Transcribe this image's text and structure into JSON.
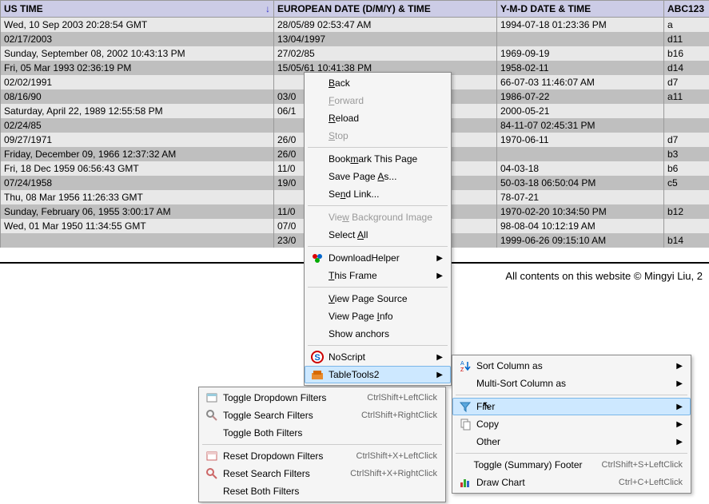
{
  "table": {
    "headers": [
      "US TIME",
      "EUROPEAN DATE (D/M/Y) & TIME",
      "Y-M-D DATE & TIME",
      "ABC123"
    ],
    "sort_col": 0,
    "rows": [
      [
        "Wed, 10 Sep 2003 20:28:54 GMT",
        "28/05/89 02:53:47 AM",
        "1994-07-18 01:23:36 PM",
        "a"
      ],
      [
        "02/17/2003",
        "13/04/1997",
        "",
        "d11"
      ],
      [
        "Sunday, September 08, 2002 10:43:13 PM",
        "27/02/85",
        "1969-09-19",
        "b16"
      ],
      [
        "Fri, 05 Mar 1993 02:36:19 PM",
        "15/05/61 10:41:38 PM",
        "1958-02-11",
        "d14"
      ],
      [
        "02/02/1991",
        "",
        "66-07-03 11:46:07 AM",
        "d7"
      ],
      [
        "08/16/90",
        "03/0",
        "1986-07-22",
        "a11"
      ],
      [
        "Saturday, April 22, 1989 12:55:58 PM",
        "06/1",
        "2000-05-21",
        ""
      ],
      [
        "02/24/85",
        "",
        "84-11-07 02:45:31 PM",
        ""
      ],
      [
        "09/27/1971",
        "26/0",
        "1970-06-11",
        "d7"
      ],
      [
        "Friday, December 09, 1966 12:37:32 AM",
        "26/0",
        "",
        "b3"
      ],
      [
        "Fri, 18 Dec 1959 06:56:43 GMT",
        "11/0",
        "04-03-18",
        "b6"
      ],
      [
        "07/24/1958",
        "19/0",
        "50-03-18 06:50:04 PM",
        "c5"
      ],
      [
        "Thu, 08 Mar 1956 11:26:33 GMT",
        "",
        "78-07-21",
        ""
      ],
      [
        "Sunday, February 06, 1955 3:00:17 AM",
        "11/0",
        "1970-02-20 10:34:50 PM",
        "b12"
      ],
      [
        "Wed, 01 Mar 1950 11:34:55 GMT",
        "07/0",
        "98-08-04 10:12:19 AM",
        ""
      ],
      [
        "",
        "23/0",
        "1999-06-26 09:15:10 AM",
        "b14"
      ]
    ]
  },
  "ctx1": {
    "back": "Back",
    "forward": "Forward",
    "reload": "Reload",
    "stop": "Stop",
    "bookmark": "Bookmark This Page",
    "savepageas": "Save Page As...",
    "sendlink": "Send Link...",
    "viewbg": "View Background Image",
    "selectall": "Select All",
    "dlhelper": "DownloadHelper",
    "thisframe": "This Frame",
    "viewsrc": "View Page Source",
    "viewinfo": "View Page Info",
    "anchors": "Show anchors",
    "noscript": "NoScript",
    "tabletools": "TableTools2"
  },
  "ctx2": {
    "sortcol": "Sort Column as",
    "multisort": "Multi-Sort Column as",
    "filter": "Filter",
    "copy": "Copy",
    "other": "Other",
    "tfoot": "Toggle (Summary) Footer",
    "tfoot_sc": "CtrlShift+S+LeftClick",
    "drawchart": "Draw Chart",
    "drawchart_sc": "Ctrl+C+LeftClick"
  },
  "ctx3": {
    "tdf": "Toggle Dropdown Filters",
    "tdf_sc": "CtrlShift+LeftClick",
    "tsf": "Toggle Search Filters",
    "tsf_sc": "CtrlShift+RightClick",
    "tbf": "Toggle Both Filters",
    "rdf": "Reset Dropdown Filters",
    "rdf_sc": "CtrlShift+X+LeftClick",
    "rsf": "Reset Search Filters",
    "rsf_sc": "CtrlShift+X+RightClick",
    "rbf": "Reset Both Filters"
  },
  "footer": "All contents on this website © Mingyi Liu, 2"
}
